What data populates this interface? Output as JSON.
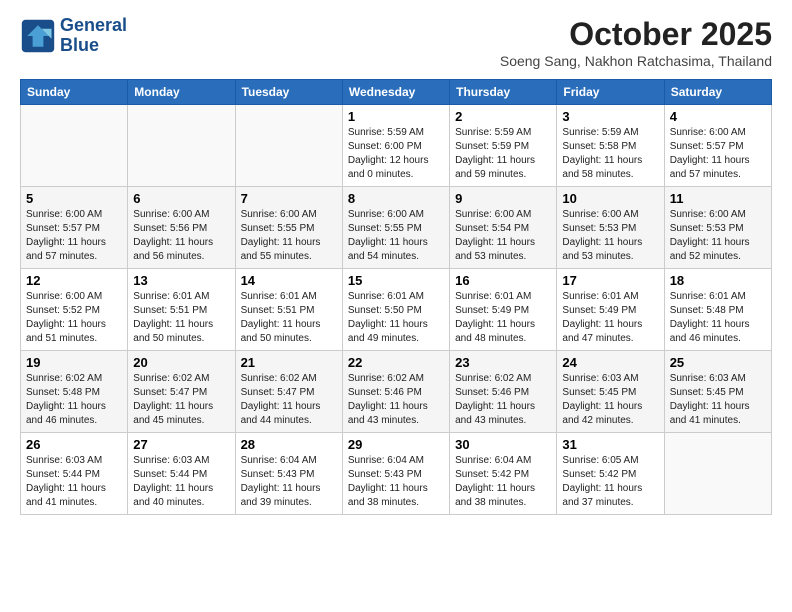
{
  "header": {
    "logo_line1": "General",
    "logo_line2": "Blue",
    "month": "October 2025",
    "location": "Soeng Sang, Nakhon Ratchasima, Thailand"
  },
  "days_of_week": [
    "Sunday",
    "Monday",
    "Tuesday",
    "Wednesday",
    "Thursday",
    "Friday",
    "Saturday"
  ],
  "weeks": [
    [
      {
        "day": "",
        "text": ""
      },
      {
        "day": "",
        "text": ""
      },
      {
        "day": "",
        "text": ""
      },
      {
        "day": "1",
        "text": "Sunrise: 5:59 AM\nSunset: 6:00 PM\nDaylight: 12 hours and 0 minutes."
      },
      {
        "day": "2",
        "text": "Sunrise: 5:59 AM\nSunset: 5:59 PM\nDaylight: 11 hours and 59 minutes."
      },
      {
        "day": "3",
        "text": "Sunrise: 5:59 AM\nSunset: 5:58 PM\nDaylight: 11 hours and 58 minutes."
      },
      {
        "day": "4",
        "text": "Sunrise: 6:00 AM\nSunset: 5:57 PM\nDaylight: 11 hours and 57 minutes."
      }
    ],
    [
      {
        "day": "5",
        "text": "Sunrise: 6:00 AM\nSunset: 5:57 PM\nDaylight: 11 hours and 57 minutes."
      },
      {
        "day": "6",
        "text": "Sunrise: 6:00 AM\nSunset: 5:56 PM\nDaylight: 11 hours and 56 minutes."
      },
      {
        "day": "7",
        "text": "Sunrise: 6:00 AM\nSunset: 5:55 PM\nDaylight: 11 hours and 55 minutes."
      },
      {
        "day": "8",
        "text": "Sunrise: 6:00 AM\nSunset: 5:55 PM\nDaylight: 11 hours and 54 minutes."
      },
      {
        "day": "9",
        "text": "Sunrise: 6:00 AM\nSunset: 5:54 PM\nDaylight: 11 hours and 53 minutes."
      },
      {
        "day": "10",
        "text": "Sunrise: 6:00 AM\nSunset: 5:53 PM\nDaylight: 11 hours and 53 minutes."
      },
      {
        "day": "11",
        "text": "Sunrise: 6:00 AM\nSunset: 5:53 PM\nDaylight: 11 hours and 52 minutes."
      }
    ],
    [
      {
        "day": "12",
        "text": "Sunrise: 6:00 AM\nSunset: 5:52 PM\nDaylight: 11 hours and 51 minutes."
      },
      {
        "day": "13",
        "text": "Sunrise: 6:01 AM\nSunset: 5:51 PM\nDaylight: 11 hours and 50 minutes."
      },
      {
        "day": "14",
        "text": "Sunrise: 6:01 AM\nSunset: 5:51 PM\nDaylight: 11 hours and 50 minutes."
      },
      {
        "day": "15",
        "text": "Sunrise: 6:01 AM\nSunset: 5:50 PM\nDaylight: 11 hours and 49 minutes."
      },
      {
        "day": "16",
        "text": "Sunrise: 6:01 AM\nSunset: 5:49 PM\nDaylight: 11 hours and 48 minutes."
      },
      {
        "day": "17",
        "text": "Sunrise: 6:01 AM\nSunset: 5:49 PM\nDaylight: 11 hours and 47 minutes."
      },
      {
        "day": "18",
        "text": "Sunrise: 6:01 AM\nSunset: 5:48 PM\nDaylight: 11 hours and 46 minutes."
      }
    ],
    [
      {
        "day": "19",
        "text": "Sunrise: 6:02 AM\nSunset: 5:48 PM\nDaylight: 11 hours and 46 minutes."
      },
      {
        "day": "20",
        "text": "Sunrise: 6:02 AM\nSunset: 5:47 PM\nDaylight: 11 hours and 45 minutes."
      },
      {
        "day": "21",
        "text": "Sunrise: 6:02 AM\nSunset: 5:47 PM\nDaylight: 11 hours and 44 minutes."
      },
      {
        "day": "22",
        "text": "Sunrise: 6:02 AM\nSunset: 5:46 PM\nDaylight: 11 hours and 43 minutes."
      },
      {
        "day": "23",
        "text": "Sunrise: 6:02 AM\nSunset: 5:46 PM\nDaylight: 11 hours and 43 minutes."
      },
      {
        "day": "24",
        "text": "Sunrise: 6:03 AM\nSunset: 5:45 PM\nDaylight: 11 hours and 42 minutes."
      },
      {
        "day": "25",
        "text": "Sunrise: 6:03 AM\nSunset: 5:45 PM\nDaylight: 11 hours and 41 minutes."
      }
    ],
    [
      {
        "day": "26",
        "text": "Sunrise: 6:03 AM\nSunset: 5:44 PM\nDaylight: 11 hours and 41 minutes."
      },
      {
        "day": "27",
        "text": "Sunrise: 6:03 AM\nSunset: 5:44 PM\nDaylight: 11 hours and 40 minutes."
      },
      {
        "day": "28",
        "text": "Sunrise: 6:04 AM\nSunset: 5:43 PM\nDaylight: 11 hours and 39 minutes."
      },
      {
        "day": "29",
        "text": "Sunrise: 6:04 AM\nSunset: 5:43 PM\nDaylight: 11 hours and 38 minutes."
      },
      {
        "day": "30",
        "text": "Sunrise: 6:04 AM\nSunset: 5:42 PM\nDaylight: 11 hours and 38 minutes."
      },
      {
        "day": "31",
        "text": "Sunrise: 6:05 AM\nSunset: 5:42 PM\nDaylight: 11 hours and 37 minutes."
      },
      {
        "day": "",
        "text": ""
      }
    ]
  ]
}
